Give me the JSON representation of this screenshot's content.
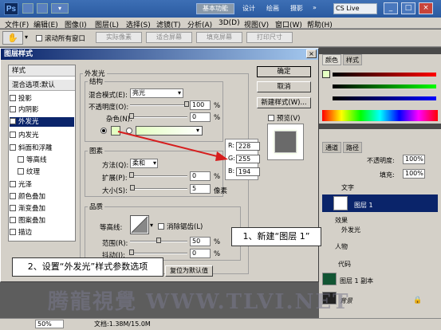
{
  "titlebar": {
    "logo": "Ps",
    "basic_btn": "基本功能",
    "items": [
      "设计",
      "绘画",
      "摄影"
    ],
    "cs_live": "CS Live",
    "win_min": "_",
    "win_max": "□",
    "win_close": "×"
  },
  "menu": [
    "文件(F)",
    "编辑(E)",
    "图像(I)",
    "图层(L)",
    "选择(S)",
    "滤镜(T)",
    "分析(A)",
    "3D(D)",
    "视图(V)",
    "窗口(W)",
    "帮助(H)"
  ],
  "options": {
    "scroll_all": "滚动所有窗口",
    "actual_pixels": "实际像素",
    "fit_screen": "适合屏幕",
    "fill_screen": "填充屏幕",
    "print_size": "打印尺寸"
  },
  "dialog": {
    "title": "图层样式",
    "styles_header": "样式",
    "blend_default": "混合选项:默认",
    "styles": [
      "投影",
      "内阴影",
      "外发光",
      "内发光",
      "斜面和浮雕",
      "等高线",
      "纹理",
      "光泽",
      "颜色叠加",
      "渐变叠加",
      "图案叠加",
      "描边"
    ],
    "outer_glow": "外发光",
    "structure": "结构",
    "blend_mode_label": "混合模式(E):",
    "blend_mode_value": "亮光",
    "opacity_label": "不透明度(O):",
    "opacity_value": "100",
    "noise_label": "杂色(N):",
    "noise_value": "0",
    "percent": "%",
    "elements": "图素",
    "technique_label": "方法(Q):",
    "technique_value": "柔和",
    "spread_label": "扩展(P):",
    "spread_value": "0",
    "size_label": "大小(S):",
    "size_value": "5",
    "px": "像素",
    "quality": "品质",
    "contour_label": "等高线:",
    "antialias": "消除锯齿(L)",
    "range_label": "范围(R):",
    "range_value": "50",
    "jitter_label": "抖动(J):",
    "jitter_value": "0",
    "reset_default": "复位为默认值",
    "ok": "确定",
    "cancel": "取消",
    "new_style": "新建样式(W)...",
    "preview": "预览(V)"
  },
  "rgb": {
    "r_label": "R:",
    "r": "228",
    "g_label": "G:",
    "g": "255",
    "b_label": "B:",
    "b": "194",
    "color_hex": "#e4ffc2"
  },
  "callouts": {
    "step1": "1、新建“图层 1”",
    "step2": "2、设置“外发光”样式参数选项"
  },
  "right_panel": {
    "tab_color": "颜色",
    "tab_swatch": "样式",
    "tab_channels": "通道",
    "tab_paths": "路径",
    "opacity_label": "不透明度:",
    "opacity_value": "100%",
    "fill_label": "填充:",
    "fill_value": "100%",
    "layers": [
      "文字",
      "图层 1",
      "效果",
      "外发光",
      "人物",
      "代码",
      "图层 1 副本",
      "背景"
    ]
  },
  "status": {
    "zoom": "50%",
    "doc": "文档:1.38M/15.0M"
  },
  "watermark": "腾龍視覺 WWW.TLVI.NET"
}
